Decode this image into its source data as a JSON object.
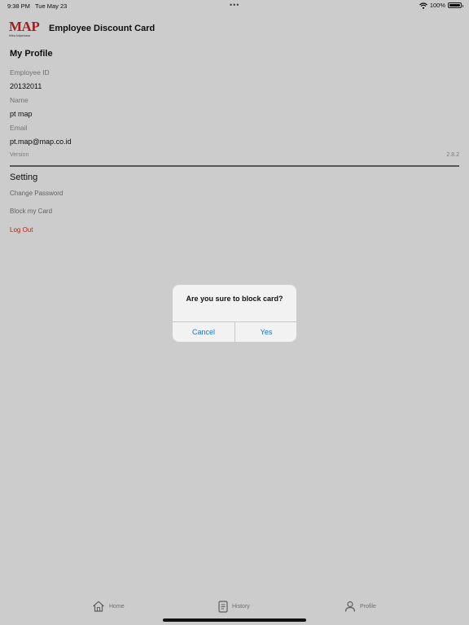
{
  "status_bar": {
    "time": "9:38 PM",
    "date": "Tue May 23",
    "dots": "•••",
    "battery": "100%",
    "icons": [
      "wifi-icon",
      "battery-icon"
    ]
  },
  "header": {
    "logo_mark": "MAP",
    "logo_sub": "Mitra Adiperkasa",
    "title": "Employee Discount Card"
  },
  "profile": {
    "title": "My Profile",
    "fields": [
      {
        "label": "Employee ID",
        "value": "20132011"
      },
      {
        "label": "Name",
        "value": "pt map"
      },
      {
        "label": "Email",
        "value": "pt.map@map.co.id"
      }
    ],
    "version_label": "Version",
    "version_value": "2.8.2"
  },
  "setting": {
    "title": "Setting",
    "items": [
      "Change Password",
      "Block my Card",
      "Log Out"
    ]
  },
  "alert": {
    "message": "Are you sure to block card?",
    "cancel": "Cancel",
    "confirm": "Yes"
  },
  "tabs": [
    {
      "label": "Home",
      "icon": "home-icon"
    },
    {
      "label": "History",
      "icon": "history-icon"
    },
    {
      "label": "Profile",
      "icon": "profile-icon"
    }
  ],
  "colors": {
    "brand_red": "#c62828",
    "logout_red": "#d93025",
    "link_blue": "#1a73c9"
  }
}
